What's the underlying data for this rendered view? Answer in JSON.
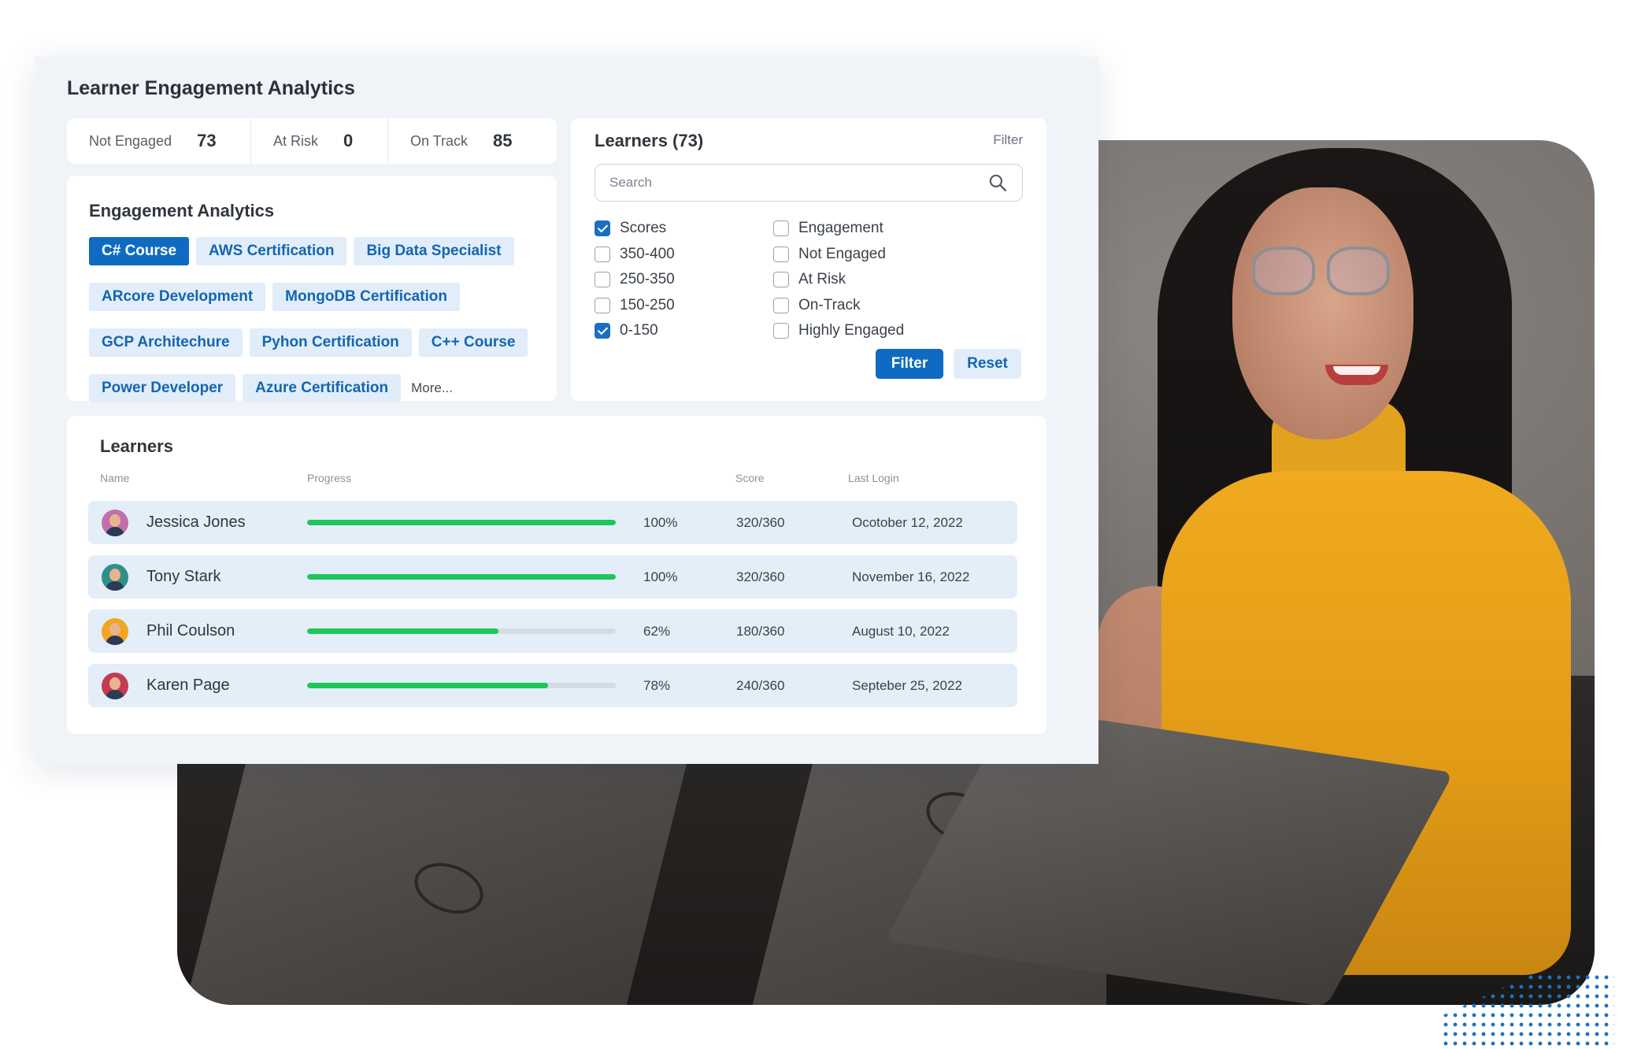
{
  "panel": {
    "title": "Learner Engagement Analytics"
  },
  "stats": [
    {
      "label": "Not Engaged",
      "value": "73"
    },
    {
      "label": "At Risk",
      "value": "0"
    },
    {
      "label": "On Track",
      "value": "85"
    }
  ],
  "engagement_analytics": {
    "title": "Engagement Analytics",
    "tags": [
      {
        "label": "C# Course",
        "active": true
      },
      {
        "label": "AWS Certification",
        "active": false
      },
      {
        "label": "Big Data Specialist",
        "active": false
      },
      {
        "label": "ARcore Development",
        "active": false
      },
      {
        "label": "MongoDB Certification",
        "active": false
      },
      {
        "label": "GCP Architechure",
        "active": false
      },
      {
        "label": "Pyhon Certification",
        "active": false
      },
      {
        "label": "C++ Course",
        "active": false
      },
      {
        "label": "Power Developer",
        "active": false
      },
      {
        "label": "Azure Certification",
        "active": false
      }
    ],
    "more_label": "More..."
  },
  "learner_filter": {
    "title": "Learners (73)",
    "filter_link": "Filter",
    "search_placeholder": "Search",
    "scores": {
      "header": {
        "label": "Scores",
        "checked": true
      },
      "options": [
        {
          "label": "350-400",
          "checked": false
        },
        {
          "label": "250-350",
          "checked": false
        },
        {
          "label": "150-250",
          "checked": false
        },
        {
          "label": "0-150",
          "checked": true
        }
      ]
    },
    "engagement": {
      "header": {
        "label": "Engagement",
        "checked": false
      },
      "options": [
        {
          "label": "Not Engaged",
          "checked": false
        },
        {
          "label": "At Risk",
          "checked": false
        },
        {
          "label": "On-Track",
          "checked": false
        },
        {
          "label": "Highly Engaged",
          "checked": false
        }
      ]
    },
    "filter_button": "Filter",
    "reset_button": "Reset"
  },
  "learners_table": {
    "title": "Learners",
    "columns": {
      "name": "Name",
      "progress": "Progress",
      "score": "Score",
      "last_login": "Last Login"
    },
    "rows": [
      {
        "name": "Jessica Jones",
        "progress": 1.0,
        "progress_label": "100%",
        "score": "320/360",
        "last_login": "Ocotober 12, 2022",
        "avatar_color": "#c36fa9"
      },
      {
        "name": "Tony Stark",
        "progress": 1.0,
        "progress_label": "100%",
        "score": "320/360",
        "last_login": "November 16, 2022",
        "avatar_color": "#2f8f8a"
      },
      {
        "name": "Phil Coulson",
        "progress": 0.62,
        "progress_label": "62%",
        "score": "180/360",
        "last_login": "August 10, 2022",
        "avatar_color": "#f2a51f"
      },
      {
        "name": "Karen Page",
        "progress": 0.78,
        "progress_label": "78%",
        "score": "240/360",
        "last_login": "Septeber 25, 2022",
        "avatar_color": "#c43c52"
      }
    ]
  },
  "colors": {
    "accent": "#0f6bc2",
    "tag_bg": "#e1edf8",
    "progress_fill": "#1ec65b",
    "row_bg": "#e3eef9"
  },
  "icons": {
    "search": "search-icon"
  }
}
